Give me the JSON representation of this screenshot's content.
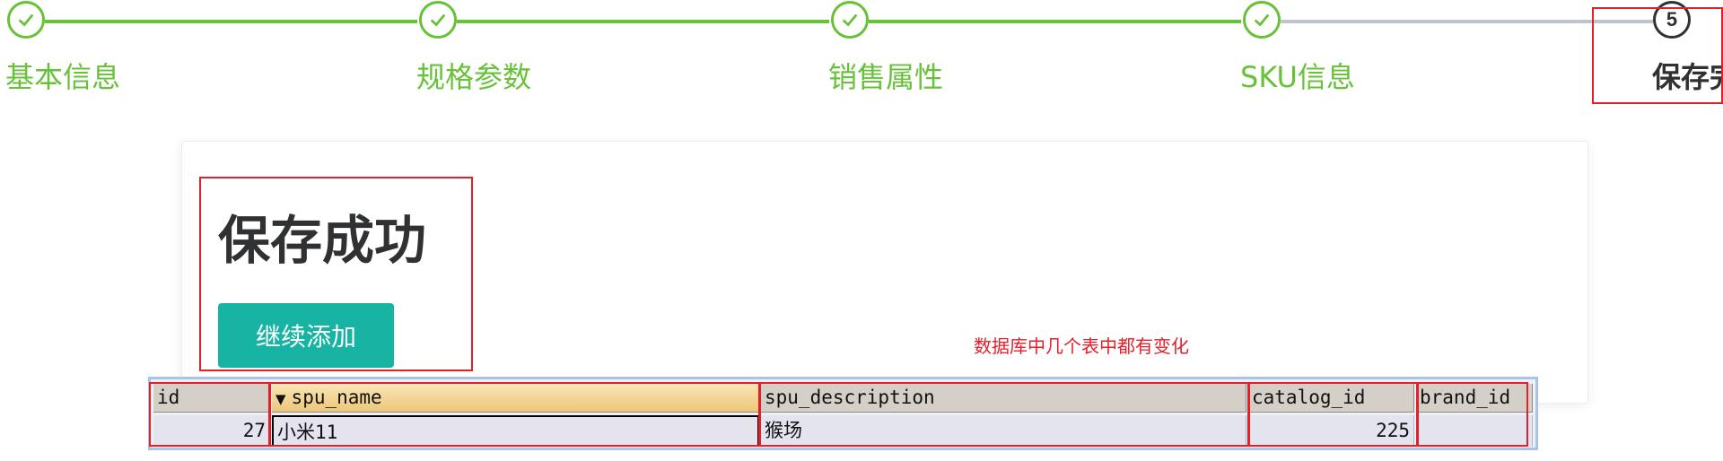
{
  "steps": [
    {
      "label": "基本信息",
      "status": "done",
      "icon": "check-icon"
    },
    {
      "label": "规格参数",
      "status": "done",
      "icon": "check-icon"
    },
    {
      "label": "销售属性",
      "status": "done",
      "icon": "check-icon"
    },
    {
      "label": "SKU信息",
      "status": "done",
      "icon": "check-icon"
    },
    {
      "label": "保存完",
      "number": "5",
      "status": "current"
    }
  ],
  "result": {
    "title": "保存成功",
    "continue_button": "继续添加"
  },
  "annotation": {
    "note": "数据库中几个表中都有变化"
  },
  "db_table": {
    "columns": [
      "id",
      "spu_name",
      "spu_description",
      "catalog_id",
      "brand_id"
    ],
    "sorted_column": "spu_name",
    "rows": [
      [
        "27",
        "小米11",
        "猴场",
        "225",
        ""
      ]
    ]
  },
  "colors": {
    "success": "#67c23a",
    "pending_line": "#c0c4cc",
    "current": "#303133",
    "button": "#17b3a3",
    "annotation_red": "#e2202a"
  }
}
